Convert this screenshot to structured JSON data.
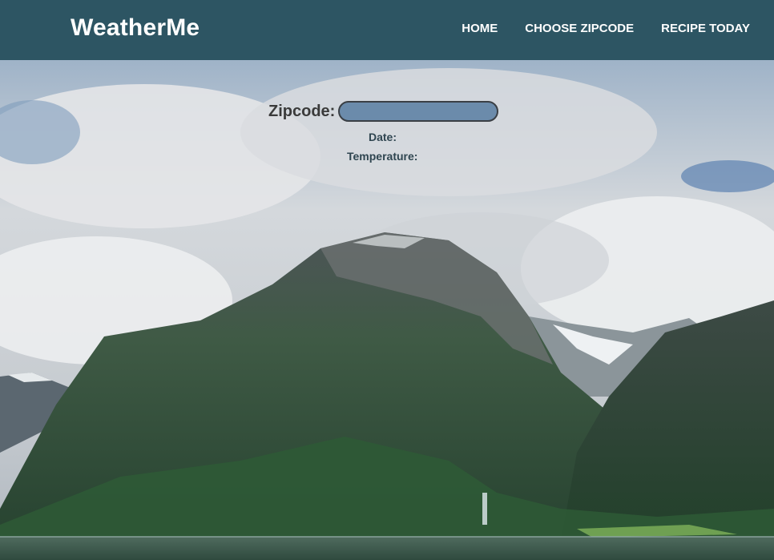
{
  "app": {
    "brand": "WeatherMe"
  },
  "nav": {
    "items": [
      {
        "label": "HOME"
      },
      {
        "label": "CHOOSE ZIPCODE"
      },
      {
        "label": "RECIPE TODAY"
      }
    ]
  },
  "form": {
    "zip_label": "Zipcode:",
    "zip_value": "",
    "date_label": "Date:",
    "date_value": "",
    "temp_label": "Temperature:",
    "temp_value": ""
  },
  "colors": {
    "navbar": "#2d5563",
    "input_fill": "#6b8bab",
    "label_text": "#2f4550"
  }
}
